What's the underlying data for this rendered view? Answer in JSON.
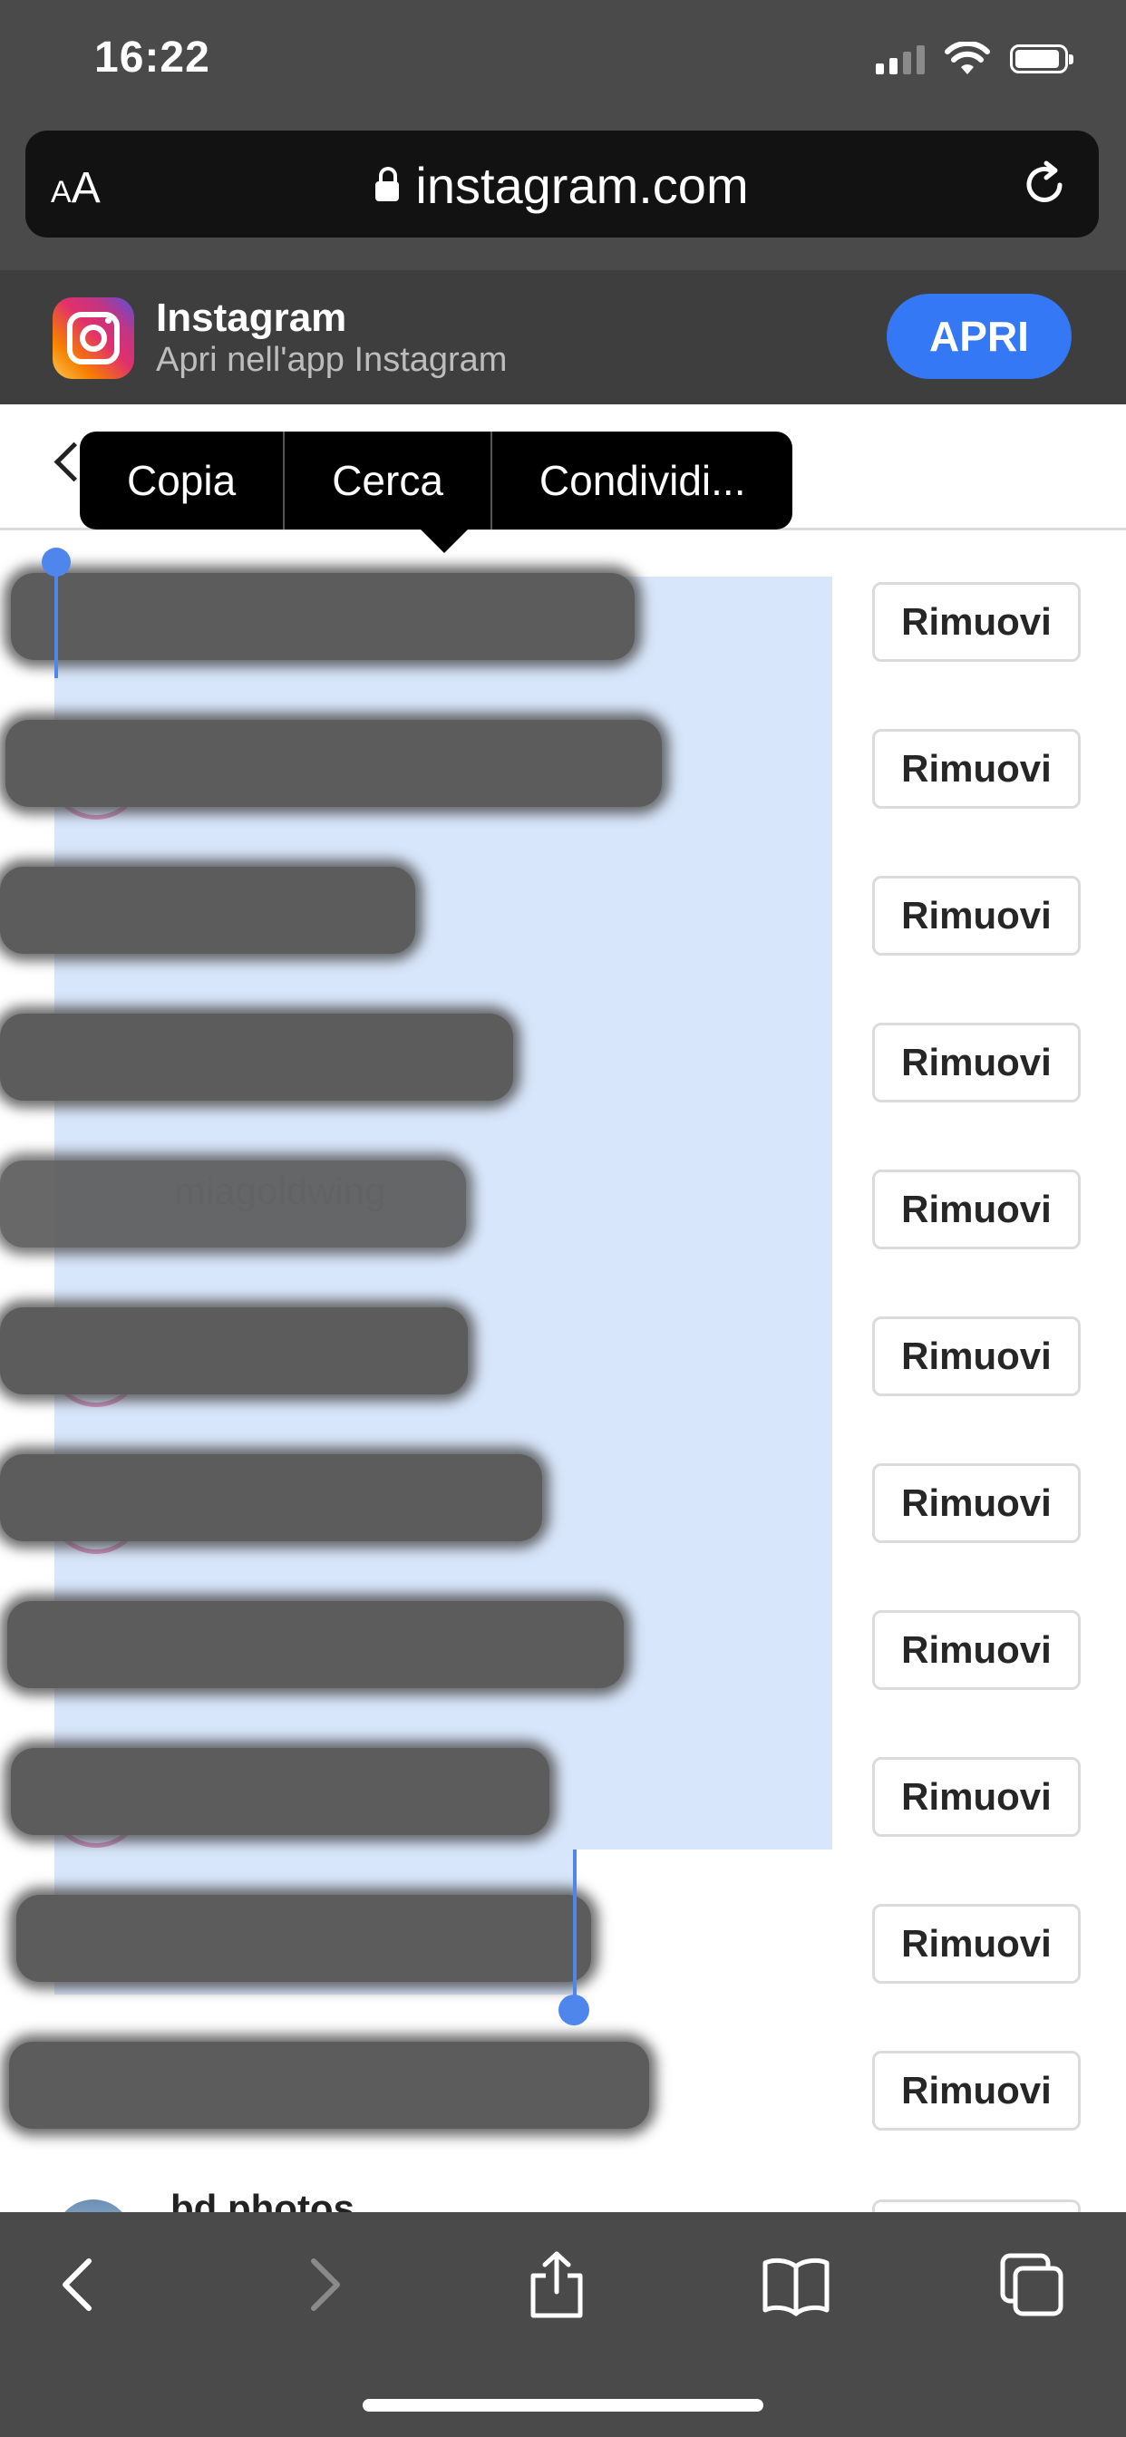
{
  "status_bar": {
    "time": "16:22"
  },
  "address_bar": {
    "text_size_label_small": "A",
    "text_size_label_large": "A",
    "domain": "instagram.com"
  },
  "app_banner": {
    "app_name": "Instagram",
    "subtitle": "Apri nell'app Instagram",
    "open_label": "APRI"
  },
  "context_menu": {
    "items": [
      "Copia",
      "Cerca",
      "Condividi..."
    ]
  },
  "followers": {
    "remove_label": "Rimuovi",
    "ghost_names": [
      "",
      "",
      "",
      "",
      "miagoldwing",
      "",
      "",
      "",
      "",
      "",
      ""
    ],
    "partial_name": "bd.photos"
  },
  "colors": {
    "accent": "#3478f6",
    "selection": "#d8e6fb",
    "chrome": "#4a4a4a"
  }
}
